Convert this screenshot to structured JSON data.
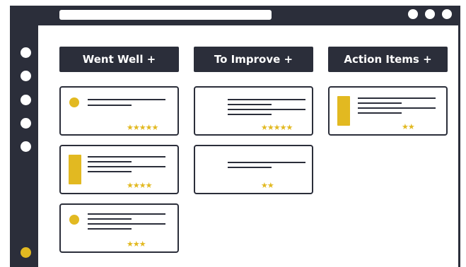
{
  "columns": [
    {
      "label": "Went Well +"
    },
    {
      "label": "To Improve +"
    },
    {
      "label": "Action Items +"
    }
  ],
  "cards": {
    "went_well": [
      {
        "marker": "dot",
        "rating": 5,
        "stars": "★★★★★"
      },
      {
        "marker": "bar",
        "rating": 4,
        "stars": "★★★★"
      },
      {
        "marker": "dot",
        "rating": 3,
        "stars": "★★★"
      }
    ],
    "to_improve": [
      {
        "marker": "none",
        "rating": 5,
        "stars": "★★★★★"
      },
      {
        "marker": "none",
        "rating": 2,
        "stars": "★★"
      }
    ],
    "action_items": [
      {
        "marker": "bar",
        "rating": 2,
        "stars": "★★"
      }
    ]
  },
  "colors": {
    "dark": "#2b2e3a",
    "accent": "#e2b921",
    "background": "#ffffff"
  },
  "icons": {
    "window_controls": [
      "window-dot-icon",
      "window-dot-icon",
      "window-dot-icon"
    ],
    "sidebar": [
      "nav-dot-icon",
      "nav-dot-icon",
      "nav-dot-icon",
      "nav-dot-icon",
      "nav-dot-icon",
      "active-nav-dot-icon"
    ]
  }
}
